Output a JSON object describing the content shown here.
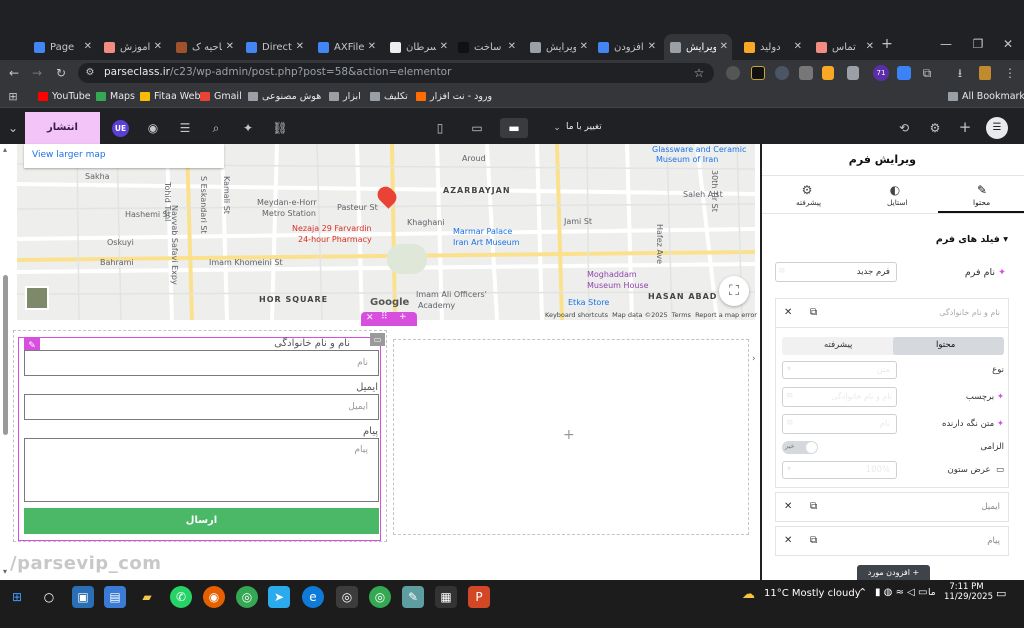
{
  "browser": {
    "tabs": [
      {
        "label": "Page",
        "color": "#4285f4"
      },
      {
        "label": "آموزش",
        "color": "#f28b82"
      },
      {
        "label": "ناحیه ک",
        "color": "#a0522d"
      },
      {
        "label": "Direct",
        "color": "#4285f4"
      },
      {
        "label": "AXFile",
        "color": "#4285f4"
      },
      {
        "label": "سرطان",
        "color": "#eeeeee"
      },
      {
        "label": "ساخت",
        "color": "#111111"
      },
      {
        "label": "ویرایش",
        "color": "#9aa0a6"
      },
      {
        "label": "افزودن",
        "color": "#4285f4"
      },
      {
        "label": "ویرایش",
        "color": "#9aa0a6"
      },
      {
        "label": "دولید",
        "color": "#f9a825"
      },
      {
        "label": "تماس",
        "color": "#f28b82"
      }
    ],
    "new_tab": "+",
    "url_host": "parseclass.ir",
    "url_path": "/c23/wp-admin/post.php?post=58&action=elementor",
    "bookmarks": [
      {
        "label": "YouTube",
        "color": "#ff0000"
      },
      {
        "label": "Maps",
        "color": "#34a853"
      },
      {
        "label": "Fitaa Web",
        "color": "#fbbc04"
      },
      {
        "label": "Gmail",
        "color": "#ea4335"
      },
      {
        "label": "هوش مصنوعی",
        "color": "#9aa0a6"
      },
      {
        "label": "ابزار",
        "color": "#9aa0a6"
      },
      {
        "label": "تکلیف",
        "color": "#9aa0a6"
      },
      {
        "label": "ورود - نت افزار",
        "color": "#ff6d00"
      }
    ],
    "all_bookmarks": "All Bookmarks",
    "extension_badge": "71"
  },
  "editor": {
    "publish": "انتشار",
    "preview_menu": "تغییر با ما",
    "user_initials": "UE"
  },
  "map": {
    "view_larger": "View larger map",
    "labels": [
      {
        "t": "Sakha"
      },
      {
        "t": "Tohid Tunl"
      },
      {
        "t": "Hashemi St"
      },
      {
        "t": "Oskuyi"
      },
      {
        "t": "Bahrami"
      },
      {
        "t": "S Eskandari St"
      },
      {
        "t": "Kamali St"
      },
      {
        "t": "Meydan-e-Horr"
      },
      {
        "t": "Metro Station"
      },
      {
        "t": "Pasteur St"
      },
      {
        "t": "Aroud"
      },
      {
        "t": "AZARBAYJAN"
      },
      {
        "t": "Khaghani"
      },
      {
        "t": "Nezaja 29 Farvardin"
      },
      {
        "t": "24-hour Pharmacy"
      },
      {
        "t": "Imam Khomeini St"
      },
      {
        "t": "HOR SQUARE"
      },
      {
        "t": "Imam Ali Officers'"
      },
      {
        "t": "Academy"
      },
      {
        "t": "Marmar Palace"
      },
      {
        "t": "Iran Art Museum"
      },
      {
        "t": "Glassware and Ceramic"
      },
      {
        "t": "Museum of Iran"
      },
      {
        "t": "Saleh Alst"
      },
      {
        "t": "Jami St"
      },
      {
        "t": "Moghaddam"
      },
      {
        "t": "Museum House"
      },
      {
        "t": "Etka Store"
      },
      {
        "t": "HASAN ABAD"
      },
      {
        "t": "Navvab Safavi Expy"
      },
      {
        "t": "Hafez Ave"
      },
      {
        "t": "30th Tir St"
      }
    ],
    "footer": [
      "Keyboard shortcuts",
      "Map data ©2025",
      "Terms",
      "Report a map error"
    ],
    "logo": "Google"
  },
  "form": {
    "name_label": "نام و نام خانوادگی",
    "name_placeholder": "نام",
    "email_label": "ایمیل",
    "email_placeholder": "ایمیل",
    "message_label": "پیام",
    "message_placeholder": "پیام",
    "submit": "ارسال",
    "button_color": "#4ab866"
  },
  "panel": {
    "title": "ویرایش فرم",
    "tabs": [
      "محتوا",
      "استایل",
      "پیشرفته"
    ],
    "section": "فیلد های فرم",
    "form_name_label": "نام فرم",
    "form_name_value": "فرم جدید",
    "item1_title": "نام و نام خانوادگی",
    "subtabs": [
      "محتوا",
      "پیشرفته"
    ],
    "type_label": "نوع",
    "type_value": "متن",
    "label_label": "برچسب",
    "label_value": "نام و نام خانوادگی",
    "placeholder_label": "متن نگه دارنده",
    "placeholder_value": "نام",
    "required_label": "الزامی",
    "required_toggle": "خیر",
    "width_label": "عرض ستون",
    "width_value": "100%",
    "item2_title": "ایمیل",
    "item3_title": "پیام",
    "add_item": "افزودن مورد"
  },
  "watermark": "/parsevip_com",
  "taskbar": {
    "weather": "11°C  Mostly cloudy",
    "lang": "ما",
    "time": "7:11 PM",
    "date": "11/29/2025"
  }
}
